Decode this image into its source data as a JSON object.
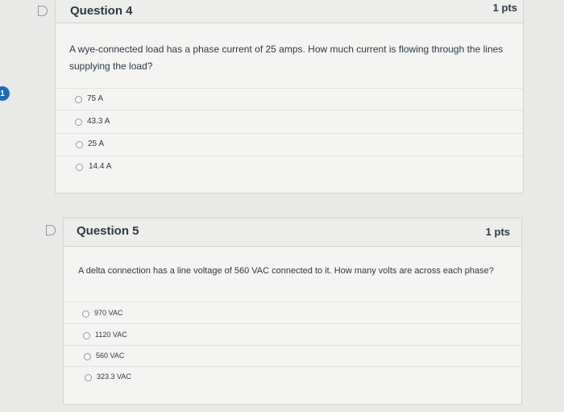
{
  "badge": "1",
  "questions": [
    {
      "title": "Question 4",
      "points": "1 pts",
      "text": "A wye-connected load has a phase current of 25 amps. How much current is flowing through the lines supplying the load?",
      "answers": [
        "75 A",
        "43.3 A",
        "25 A",
        "14.4 A"
      ]
    },
    {
      "title": "Question 5",
      "points": "1 pts",
      "text": "A delta connection has a line voltage of 560 VAC connected to it. How many volts are across each phase?",
      "answers": [
        "970 VAC",
        "1120 VAC",
        "560 VAC",
        "323.3 VAC"
      ]
    }
  ]
}
